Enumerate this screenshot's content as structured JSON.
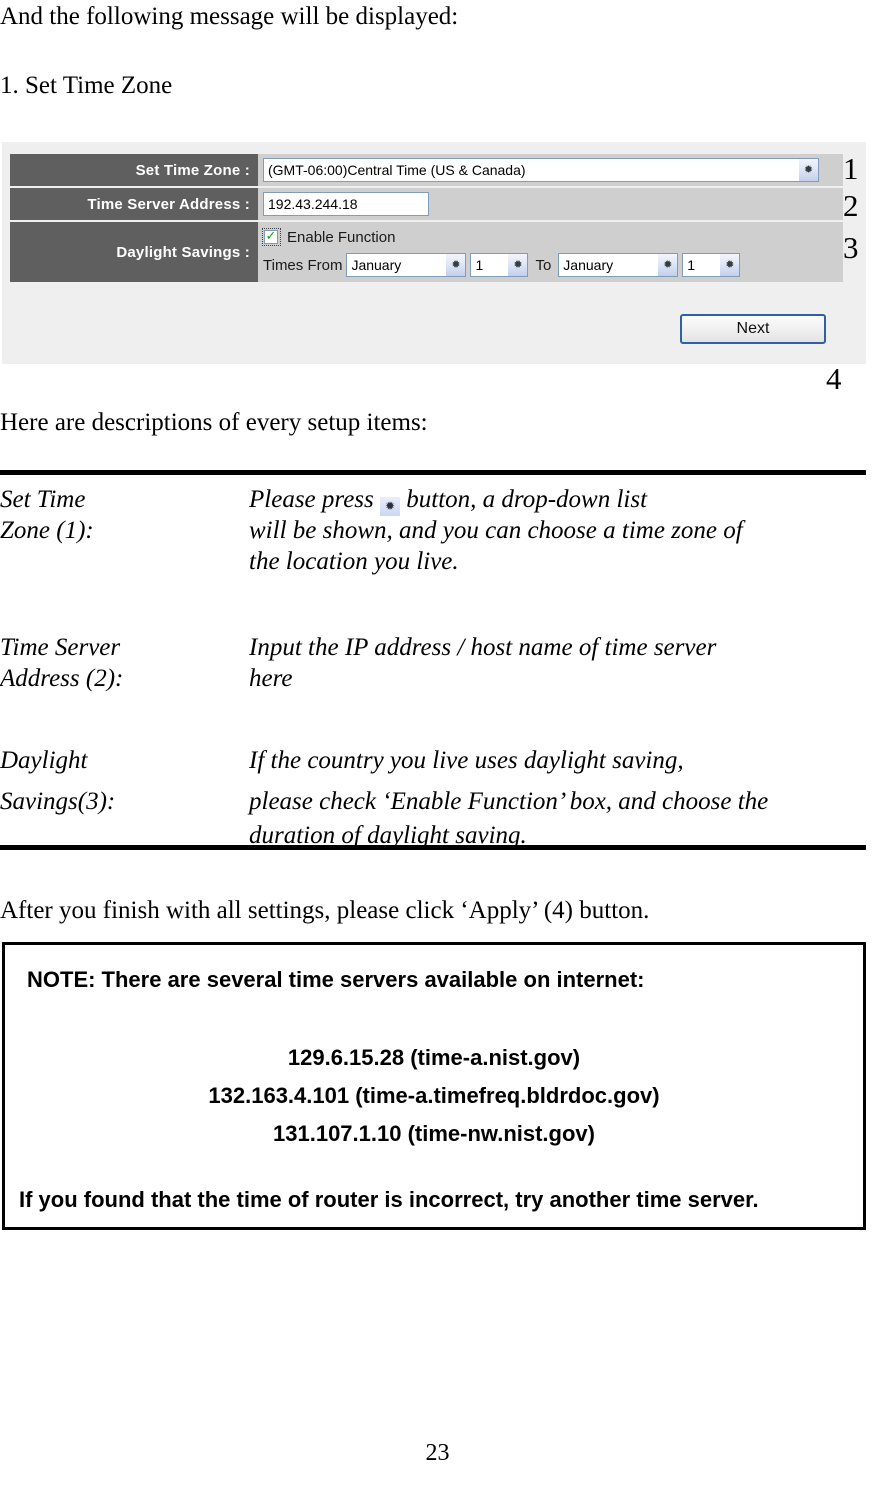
{
  "intro": {
    "line1": "And the following message will be displayed:",
    "line2": "1. Set Time Zone",
    "line3": "Here are descriptions of every setup items:"
  },
  "config_panel": {
    "rows": [
      {
        "label": "Set Time Zone :",
        "callout": "1"
      },
      {
        "label": "Time Server Address :",
        "callout": "2"
      },
      {
        "label": "Daylight Savings :",
        "callout": "3"
      }
    ],
    "timezone_value": "(GMT-06:00)Central Time (US & Canada)",
    "time_server_value": "192.43.244.18",
    "enable_function_label": "Enable Function",
    "enable_function_checked": true,
    "times_from_label": "Times From",
    "to_label": "To",
    "dst_from_month": "January",
    "dst_from_day": "1",
    "dst_to_month": "January",
    "dst_to_day": "1",
    "next_button_label": "Next",
    "next_button_callout": "4",
    "dropdown_icon": "chevron-down-icon",
    "colors": {
      "label_cell": "#5f5f5f",
      "field_cell": "#cfcfcf",
      "panel_bg": "#efefef",
      "control_border": "#7f9db9",
      "button_border": "#2f5fa8",
      "check_green": "#19a319"
    }
  },
  "descriptions": [
    {
      "term_line1": "Set Time",
      "term_line2": "Zone (1):",
      "def_line1_before": "Please press",
      "def_line1_icon": "chevron-down-icon",
      "def_line1_after": "button, a drop-down list",
      "def_line2": "will be shown, and you can choose a time zone of",
      "def_line3": "the location you live."
    },
    {
      "term_line1": "Time Server",
      "term_line2": "Address (2):",
      "def_line1": "Input the IP address / host name of time server",
      "def_line2": "here"
    },
    {
      "term_line1": "Daylight",
      "term_line2": "Savings(3):",
      "def_line1": "If the country you live uses daylight saving,",
      "def_line2": "please check ‘Enable Function’ box, and choose the",
      "def_line3": "duration of daylight saving."
    }
  ],
  "closing": {
    "apply_sentence": "After you finish with all settings, please click ‘Apply’ (4) button."
  },
  "note_box": {
    "heading": "NOTE: There are several time servers available on internet:",
    "servers": [
      "129.6.15.28 (time-a.nist.gov)",
      "132.163.4.101 (time-a.timefreq.bldrdoc.gov)",
      "131.107.1.10 (time-nw.nist.gov)"
    ],
    "footer": "If you found that the time of router is incorrect, try another time server."
  },
  "page_number": "23"
}
